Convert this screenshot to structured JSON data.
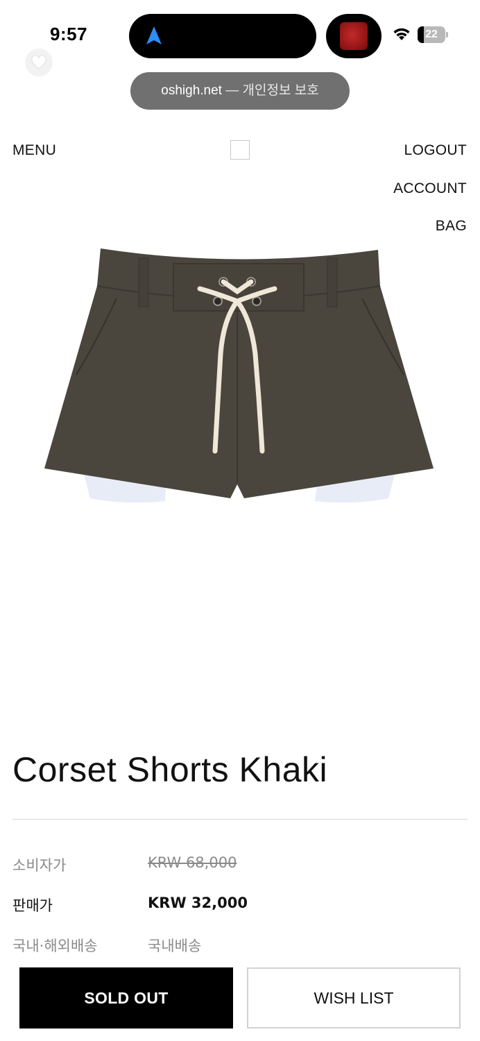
{
  "status_bar": {
    "time": "9:57",
    "battery_level": "22",
    "battery_fraction": 0.22
  },
  "browser": {
    "url_domain": "oshigh.net",
    "url_suffix": "— 개인정보 보호"
  },
  "header": {
    "menu": "MENU",
    "logout": "LOGOUT",
    "account": "ACCOUNT",
    "bag": "BAG"
  },
  "product": {
    "title": "Corset Shorts Khaki",
    "retail_price_label": "소비자가",
    "retail_price": "KRW 68,000",
    "sale_price_label": "판매가",
    "sale_price": "KRW 32,000",
    "shipping_label": "국내·해외배송",
    "shipping_value": "국내배송"
  },
  "actions": {
    "sold_out": "SOLD OUT",
    "wish_list": "WISH LIST"
  },
  "colors": {
    "shorts": "#4a463e",
    "drawstring": "#efe8d8",
    "lining": "#e8ecf6",
    "accent": "#000000"
  }
}
